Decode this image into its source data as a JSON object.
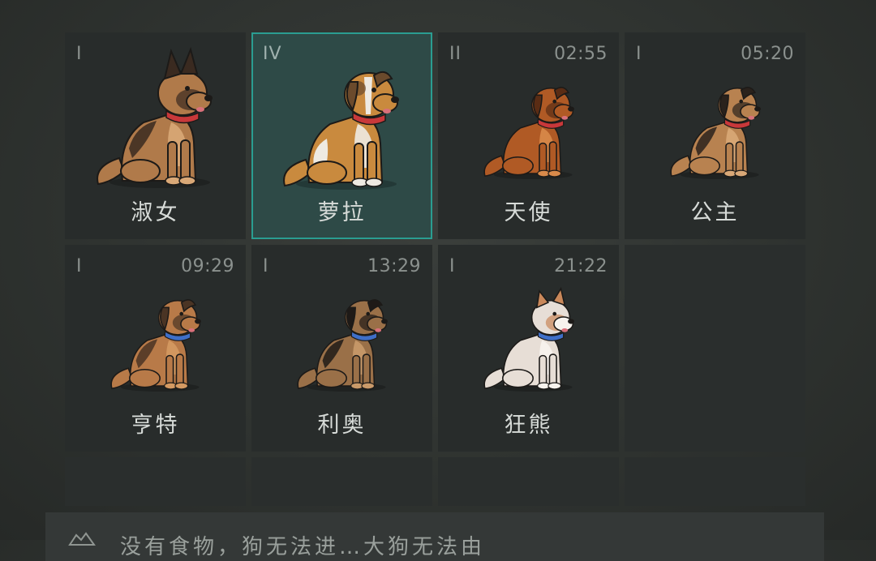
{
  "dogs": [
    {
      "tier": "I",
      "timer": "",
      "name": "淑女",
      "selected": false,
      "breed": "shepherd-adult",
      "colors": {
        "body": "#b07a4a",
        "dark": "#3a2a20",
        "light": "#d9a877",
        "collar": "#c8383a"
      }
    },
    {
      "tier": "IV",
      "timer": "",
      "name": "萝拉",
      "selected": true,
      "breed": "saint-bernard",
      "colors": {
        "body": "#c98a3e",
        "dark": "#6b4a2c",
        "light": "#eeeae2",
        "collar": "#c8383a"
      }
    },
    {
      "tier": "II",
      "timer": "02:55",
      "name": "天使",
      "selected": false,
      "breed": "chow-puppy",
      "colors": {
        "body": "#b05a25",
        "dark": "#5a2c14",
        "light": "#d98a4a",
        "collar": "#c8383a"
      }
    },
    {
      "tier": "I",
      "timer": "05:20",
      "name": "公主",
      "selected": false,
      "breed": "shepherd-puppy",
      "colors": {
        "body": "#b88250",
        "dark": "#2a221c",
        "light": "#d9a877",
        "collar": "#c8383a"
      }
    },
    {
      "tier": "I",
      "timer": "09:29",
      "name": "亨特",
      "selected": false,
      "breed": "shepherd-puppy",
      "colors": {
        "body": "#b87a48",
        "dark": "#4a3424",
        "light": "#d59a62",
        "collar": "#3f6fc8"
      }
    },
    {
      "tier": "I",
      "timer": "13:29",
      "name": "利奥",
      "selected": false,
      "breed": "shepherd-puppy",
      "colors": {
        "body": "#9a7048",
        "dark": "#1f1a17",
        "light": "#c99a6a",
        "collar": "#3f6fc8"
      }
    },
    {
      "tier": "I",
      "timer": "21:22",
      "name": "狂熊",
      "selected": false,
      "breed": "husky-puppy",
      "colors": {
        "body": "#e7ded6",
        "dark": "#c9885a",
        "light": "#f7f3ee",
        "collar": "#3f6fc8"
      }
    }
  ],
  "bottom_bar": {
    "icon": "hint-icon",
    "text": "没有食物，狗无法进…大狗无法由"
  }
}
